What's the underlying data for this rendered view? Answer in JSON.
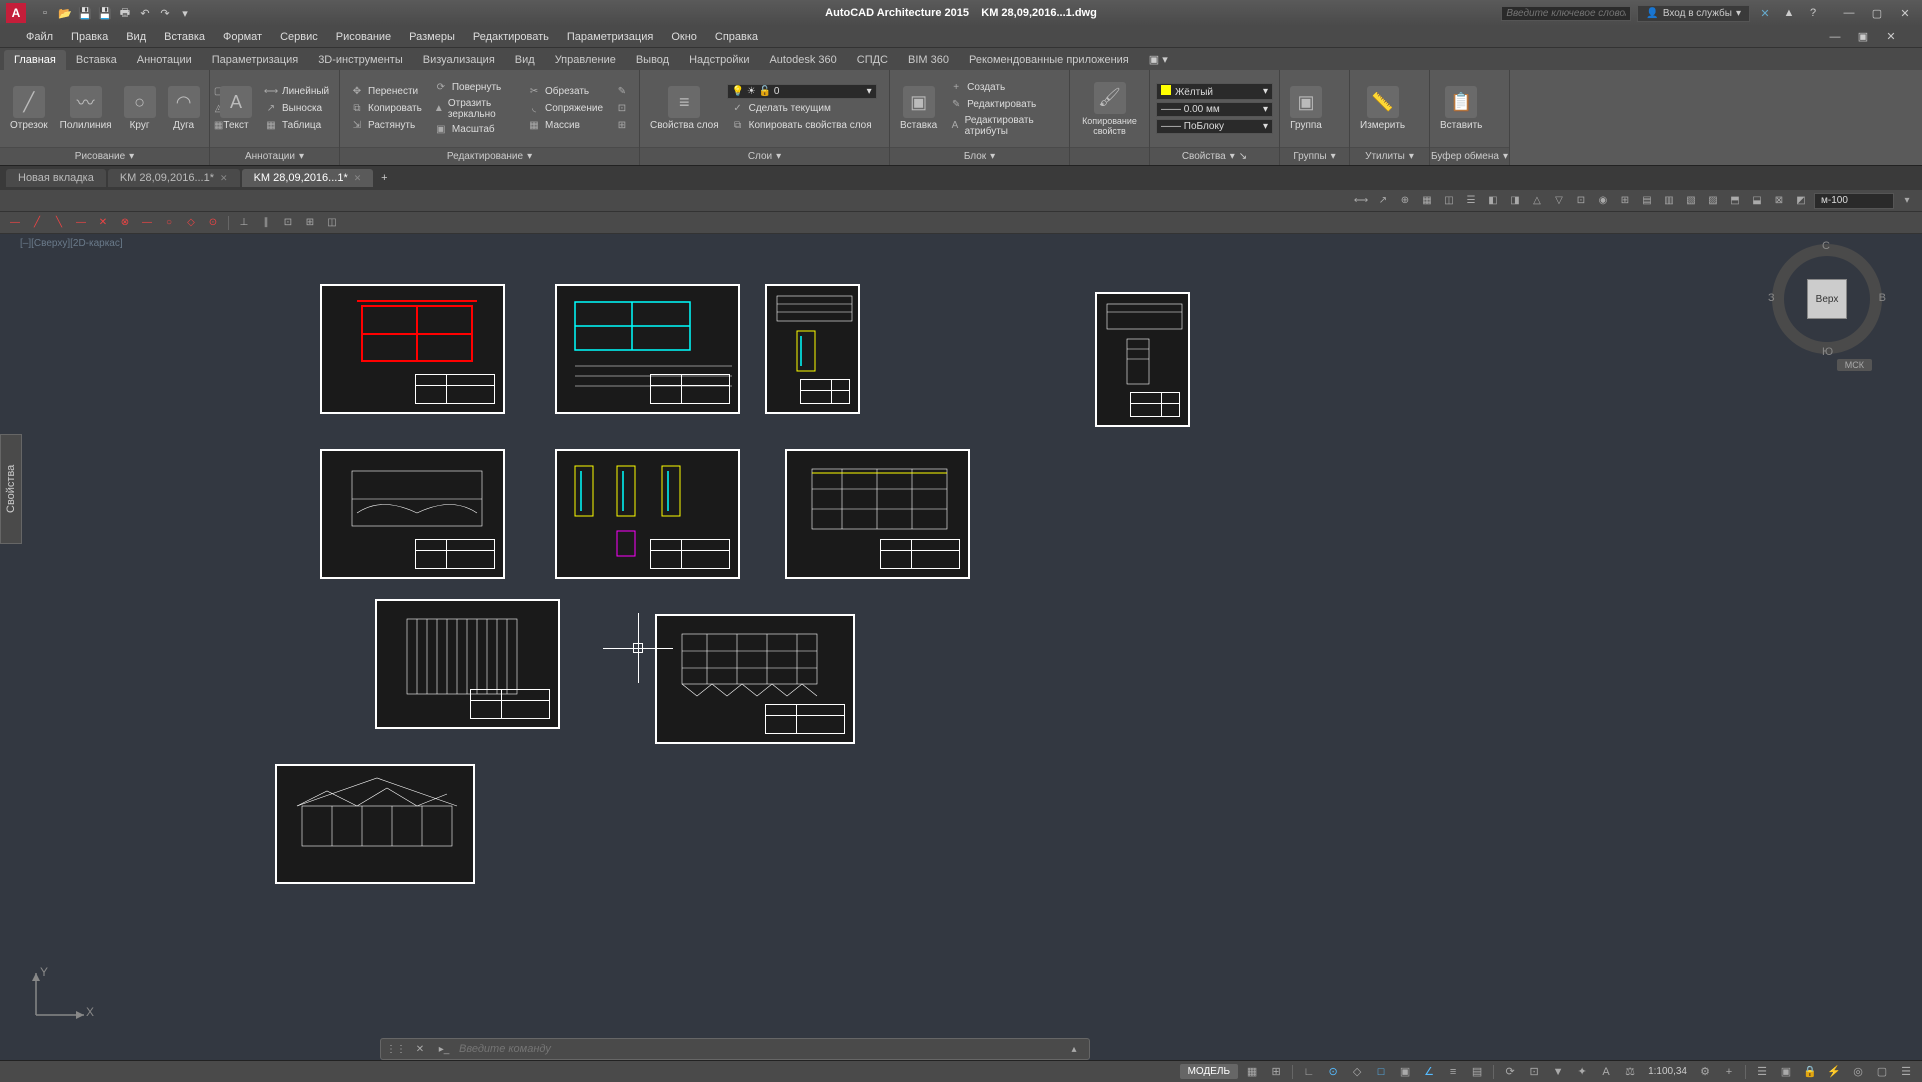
{
  "app_title": "AutoCAD Architecture 2015",
  "file_title": "KM 28,09,2016...1.dwg",
  "search_placeholder": "Введите ключевое слово/фразу",
  "login_label": "Вход в службы",
  "menus": [
    "Файл",
    "Правка",
    "Вид",
    "Вставка",
    "Формат",
    "Сервис",
    "Рисование",
    "Размеры",
    "Редактировать",
    "Параметризация",
    "Окно",
    "Справка"
  ],
  "ribbon_tabs": [
    "Главная",
    "Вставка",
    "Аннотации",
    "Параметризация",
    "3D-инструменты",
    "Визуализация",
    "Вид",
    "Управление",
    "Вывод",
    "Надстройки",
    "Autodesk 360",
    "СПДС",
    "BIM 360",
    "Рекомендованные приложения"
  ],
  "ribbon_active": 0,
  "panels": {
    "draw": {
      "title": "Рисование",
      "big": [
        {
          "label": "Отрезок"
        },
        {
          "label": "Полилиния"
        },
        {
          "label": "Круг"
        },
        {
          "label": "Дуга"
        }
      ]
    },
    "annot": {
      "title": "Аннотации",
      "big": "Текст",
      "items": [
        "Линейный",
        "Выноска",
        "Таблица"
      ]
    },
    "modify": {
      "title": "Редактирование",
      "cols": [
        [
          "Перенести",
          "Копировать",
          "Растянуть"
        ],
        [
          "Повернуть",
          "Отразить зеркально",
          "Масштаб"
        ],
        [
          "Обрезать",
          "Сопряжение",
          "Массив"
        ]
      ]
    },
    "layers": {
      "title": "Слои",
      "big": "Свойства слоя",
      "combo": "0",
      "items": [
        "Сделать текущим",
        "Копировать свойства слоя"
      ]
    },
    "block": {
      "title": "Блок",
      "big": "Вставка",
      "items": [
        "Создать",
        "Редактировать",
        "Редактировать атрибуты"
      ]
    },
    "coord": {
      "title": "",
      "big": "Копирование свойств"
    },
    "props": {
      "title": "Свойства",
      "color": "Жёлтый",
      "color_hex": "#ffff00",
      "lw": "0.00 мм",
      "lt": "ПоБлоку"
    },
    "groups": {
      "title": "Группы",
      "big": "Группа"
    },
    "utils": {
      "title": "Утилиты",
      "big": "Измерить"
    },
    "clip": {
      "title": "Буфер обмена",
      "big": "Вставить"
    }
  },
  "doc_tabs": [
    {
      "label": "Новая вкладка",
      "active": false
    },
    {
      "label": "KM 28,09,2016...1*",
      "active": false
    },
    {
      "label": "KM 28,09,2016...1*",
      "active": true
    }
  ],
  "scale_combo": "м-100",
  "view_label": "[–][Сверху][2D-каркас]",
  "viewcube": {
    "face": "Верх",
    "n": "С",
    "s": "Ю",
    "e": "В",
    "w": "З",
    "system": "МСК"
  },
  "cmd_placeholder": "Введите команду",
  "status": {
    "model": "МОДЕЛЬ",
    "scale": "1:100,34"
  },
  "ucs": {
    "x": "X",
    "y": "Y"
  }
}
